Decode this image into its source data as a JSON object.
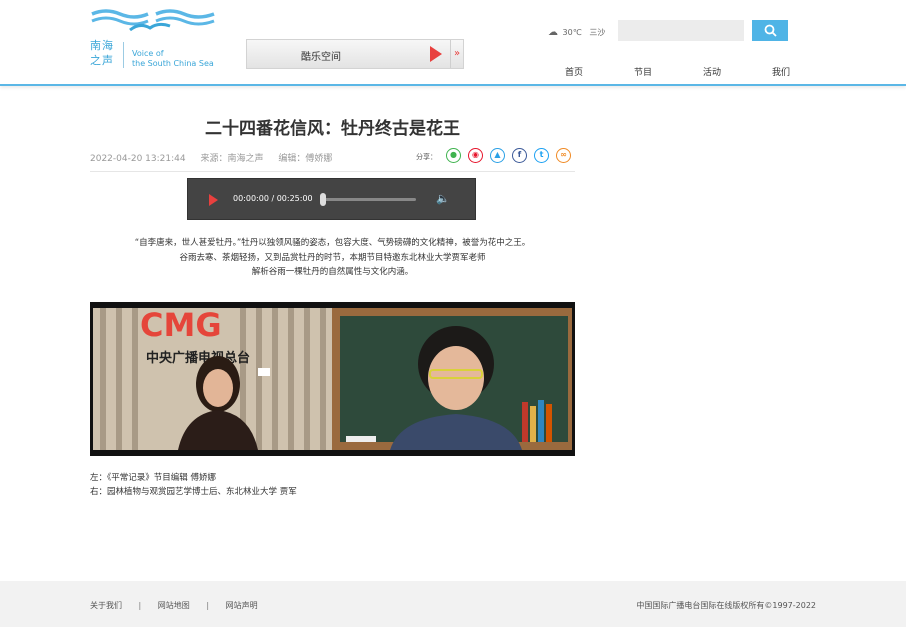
{
  "header": {
    "logo": {
      "cn": "南海之声",
      "en_line1": "Voice of",
      "en_line2": "the South China Sea"
    },
    "player": {
      "title": "酷乐空间"
    },
    "weather": {
      "temp": "30℃",
      "city": "三沙"
    },
    "search": {
      "placeholder": ""
    },
    "nav": [
      "首页",
      "节目",
      "活动",
      "我们"
    ]
  },
  "article": {
    "title": "二十四番花信风：牡丹终古是花王",
    "date": "2022-04-20 13:21:44",
    "source": "来源：南海之声",
    "editor": "编辑：傅娇娜",
    "share_label": "分享：",
    "audio_time": "00:00:00 / 00:25:00",
    "audio_progress": 0,
    "intro": [
      "“自李唐来，世人甚爱牡丹。”牡丹以独领风骚的姿态，包容大度、气势磅礴的文化精神，被誉为花中之王。",
      "谷雨去寒、茶烟轻扬，又到品赏牡丹的时节，本期节目特邀东北林业大学贾军老师",
      "解析谷雨一棵牡丹的自然属性与文化内涵。"
    ],
    "photo_sign": "中央广播电视总台",
    "captions": [
      "左：《平常记录》节目编辑  傅娇娜",
      "右：园林植物与观赏园艺学博士后、东北林业大学  贾军"
    ]
  },
  "footer": {
    "links": [
      "关于我们",
      "网站地图",
      "网站声明"
    ],
    "copyright": "中国国际广播电台国际在线版权所有©1997-2022"
  },
  "colors": {
    "accent": "#4fb4e6",
    "play": "#e8403e"
  },
  "icons": [
    "cloud-icon",
    "search-icon",
    "play-icon",
    "volume-icon",
    "wechat-icon",
    "weibo-icon",
    "qq-icon",
    "facebook-icon",
    "twitter-icon",
    "link-icon"
  ]
}
